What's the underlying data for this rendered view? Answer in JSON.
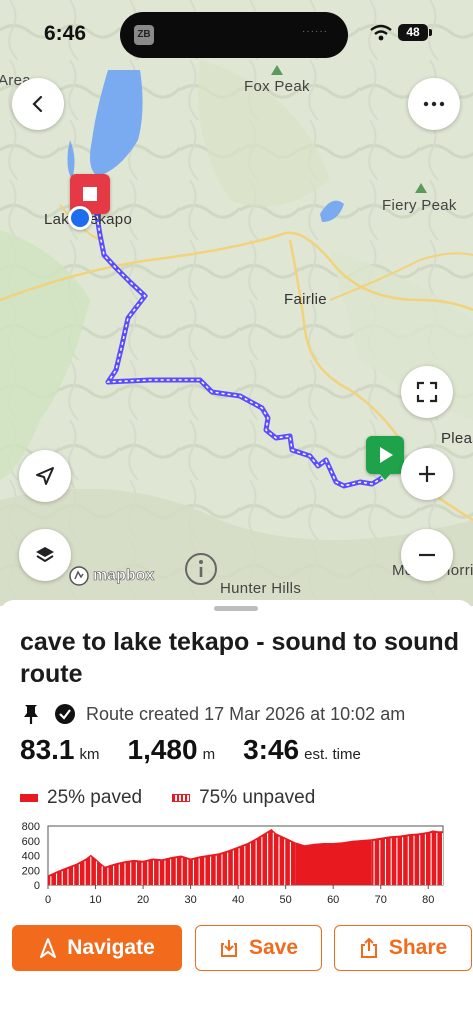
{
  "status_bar": {
    "time": "6:46",
    "battery": "48",
    "app_icon": "ZB"
  },
  "map": {
    "labels": {
      "area": "Area",
      "fox_peak": "Fox Peak",
      "fiery_peak": "Fiery Peak",
      "lake_tekapo": "Lake Tekapo",
      "fairlie": "Fairlie",
      "pleasant": "Pleas",
      "hunter_hills": "Hunter Hills",
      "mount_horrible": "Mount Horri"
    },
    "attribution": "mapbox",
    "icons": [
      "back-icon",
      "more-icon",
      "expand-icon",
      "locate-icon",
      "zoom-in-icon",
      "layers-icon",
      "zoom-out-icon",
      "info-icon"
    ]
  },
  "route": {
    "title": "cave to lake tekapo - sound to sound route",
    "created": "Route created 17 Mar 2026 at 10:02 am",
    "distance": "83.1",
    "distance_unit": "km",
    "elevation": "1,480",
    "elevation_unit": "m",
    "time": "3:46",
    "time_unit": "est. time",
    "paved": "25% paved",
    "unpaved": "75% unpaved"
  },
  "chart_data": {
    "type": "area",
    "y_ticks": [
      "800",
      "600",
      "400",
      "200",
      "0"
    ],
    "x_ticks": [
      "0",
      "10",
      "20",
      "30",
      "40",
      "50",
      "60",
      "70",
      "80"
    ],
    "ylim": [
      0,
      800
    ],
    "xlim": [
      0,
      83.1
    ],
    "x": [
      0,
      2,
      4,
      6,
      8,
      9,
      10,
      11,
      12,
      14,
      16,
      18,
      20,
      22,
      24,
      26,
      28,
      30,
      32,
      34,
      36,
      38,
      40,
      42,
      44,
      46,
      47,
      48,
      50,
      52,
      54,
      56,
      58,
      60,
      62,
      64,
      66,
      68,
      70,
      72,
      74,
      76,
      78,
      80,
      81,
      82,
      83.1
    ],
    "values": [
      130,
      190,
      240,
      290,
      360,
      410,
      360,
      300,
      250,
      290,
      320,
      340,
      330,
      360,
      350,
      380,
      400,
      360,
      390,
      410,
      430,
      470,
      520,
      570,
      640,
      720,
      760,
      700,
      640,
      580,
      540,
      560,
      570,
      570,
      580,
      600,
      610,
      620,
      640,
      660,
      670,
      690,
      700,
      720,
      740,
      730,
      730
    ],
    "segments": [
      {
        "surface": "unpaved",
        "from": 0,
        "to": 52
      },
      {
        "surface": "paved",
        "from": 52,
        "to": 68
      },
      {
        "surface": "unpaved",
        "from": 68,
        "to": 83.1
      }
    ]
  },
  "actions": {
    "navigate": "Navigate",
    "save": "Save",
    "share": "Share"
  },
  "colors": {
    "accent": "#f26b1d",
    "route": "#6b5cff",
    "elevation": "#e8191f",
    "start": "#1fa34a",
    "end": "#e63946"
  }
}
